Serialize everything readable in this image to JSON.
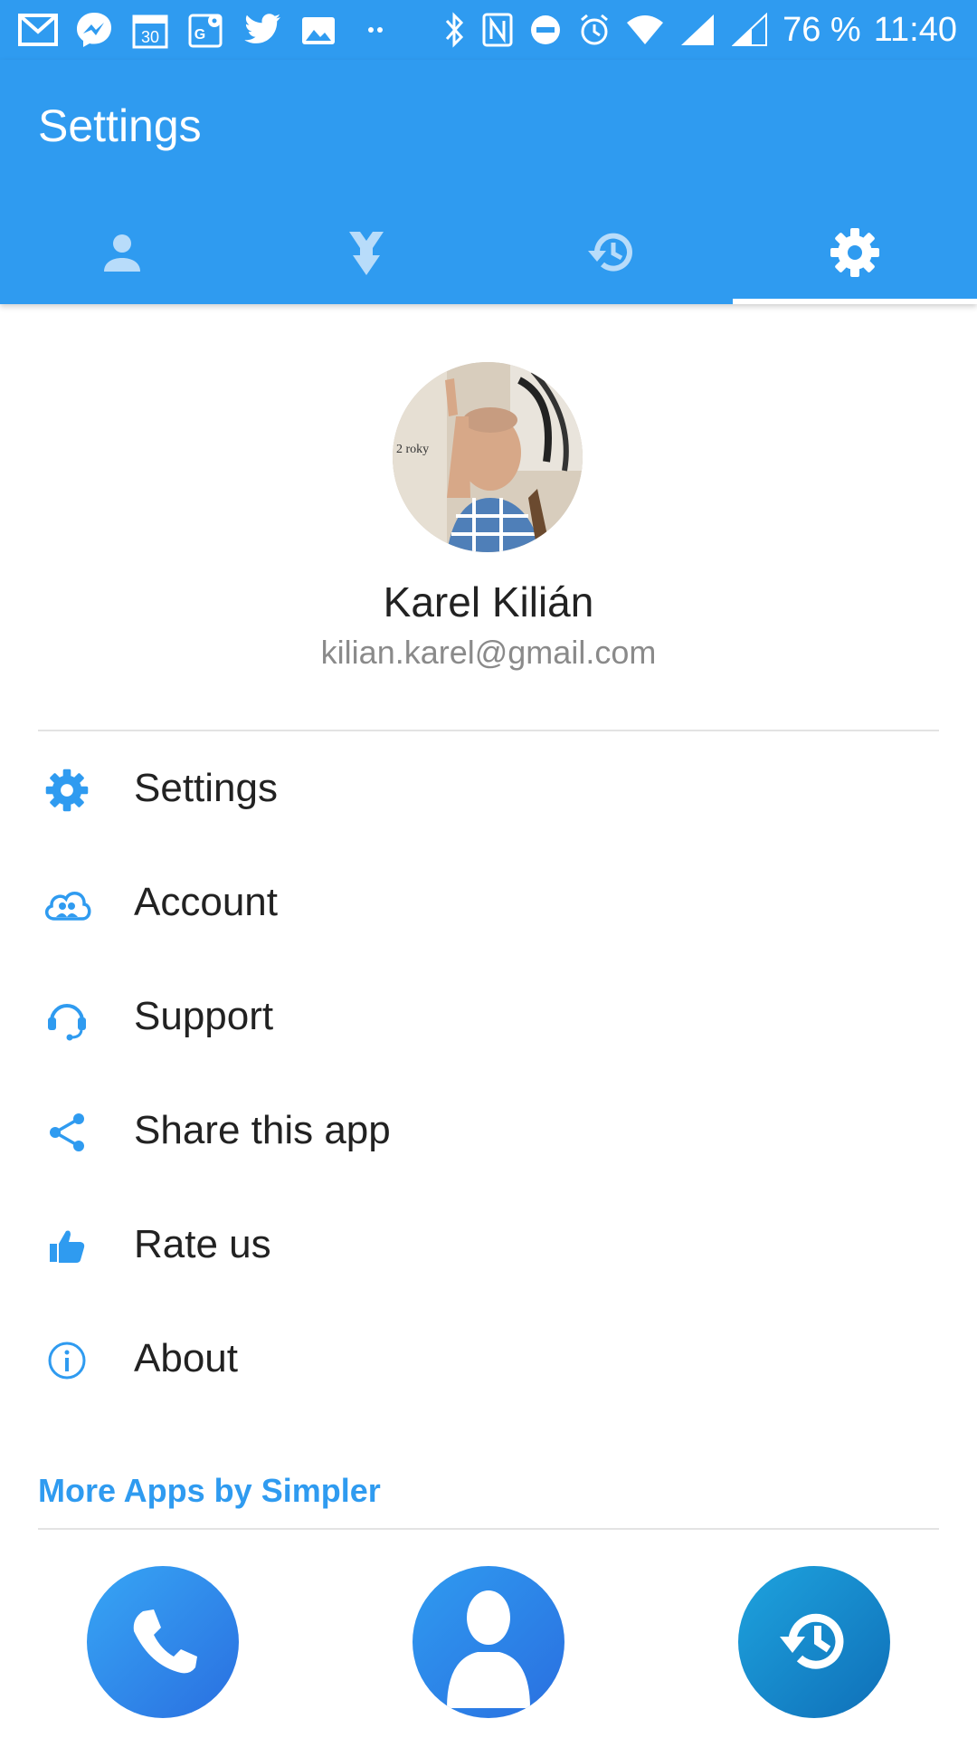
{
  "status_bar": {
    "battery_text": "76 %",
    "time": "11:40",
    "notification_icons": [
      "gmail-icon",
      "messenger-icon",
      "calendar-icon",
      "maps-icon",
      "twitter-icon",
      "gallery-icon",
      "more-dots-icon"
    ],
    "system_icons": [
      "bluetooth-icon",
      "nfc-icon",
      "do-not-disturb-icon",
      "alarm-icon",
      "wifi-icon",
      "signal-icon",
      "signal-icon"
    ],
    "calendar_day": "30"
  },
  "header": {
    "title": "Settings",
    "tabs": [
      {
        "icon": "person-icon",
        "selected": false
      },
      {
        "icon": "merge-icon",
        "selected": false
      },
      {
        "icon": "history-icon",
        "selected": false
      },
      {
        "icon": "gear-icon",
        "selected": true
      }
    ]
  },
  "profile": {
    "name": "Karel Kilián",
    "email": "kilian.karel@gmail.com",
    "photo_text": "2 roky"
  },
  "menu": {
    "items": [
      {
        "label": "Settings",
        "icon": "gear-icon"
      },
      {
        "label": "Account",
        "icon": "cloud-users-icon"
      },
      {
        "label": "Support",
        "icon": "headset-icon"
      },
      {
        "label": "Share this app",
        "icon": "share-icon"
      },
      {
        "label": "Rate us",
        "icon": "thumbs-up-icon"
      },
      {
        "label": "About",
        "icon": "info-icon"
      }
    ]
  },
  "more_apps": {
    "title": "More Apps by Simpler",
    "apps": [
      {
        "icon": "phone-icon"
      },
      {
        "icon": "contact-icon"
      },
      {
        "icon": "history-icon"
      }
    ]
  },
  "colors": {
    "primary": "#2f9bf0",
    "accent_text": "#2f9bf0",
    "tab_inactive": "#b8dcfa"
  }
}
